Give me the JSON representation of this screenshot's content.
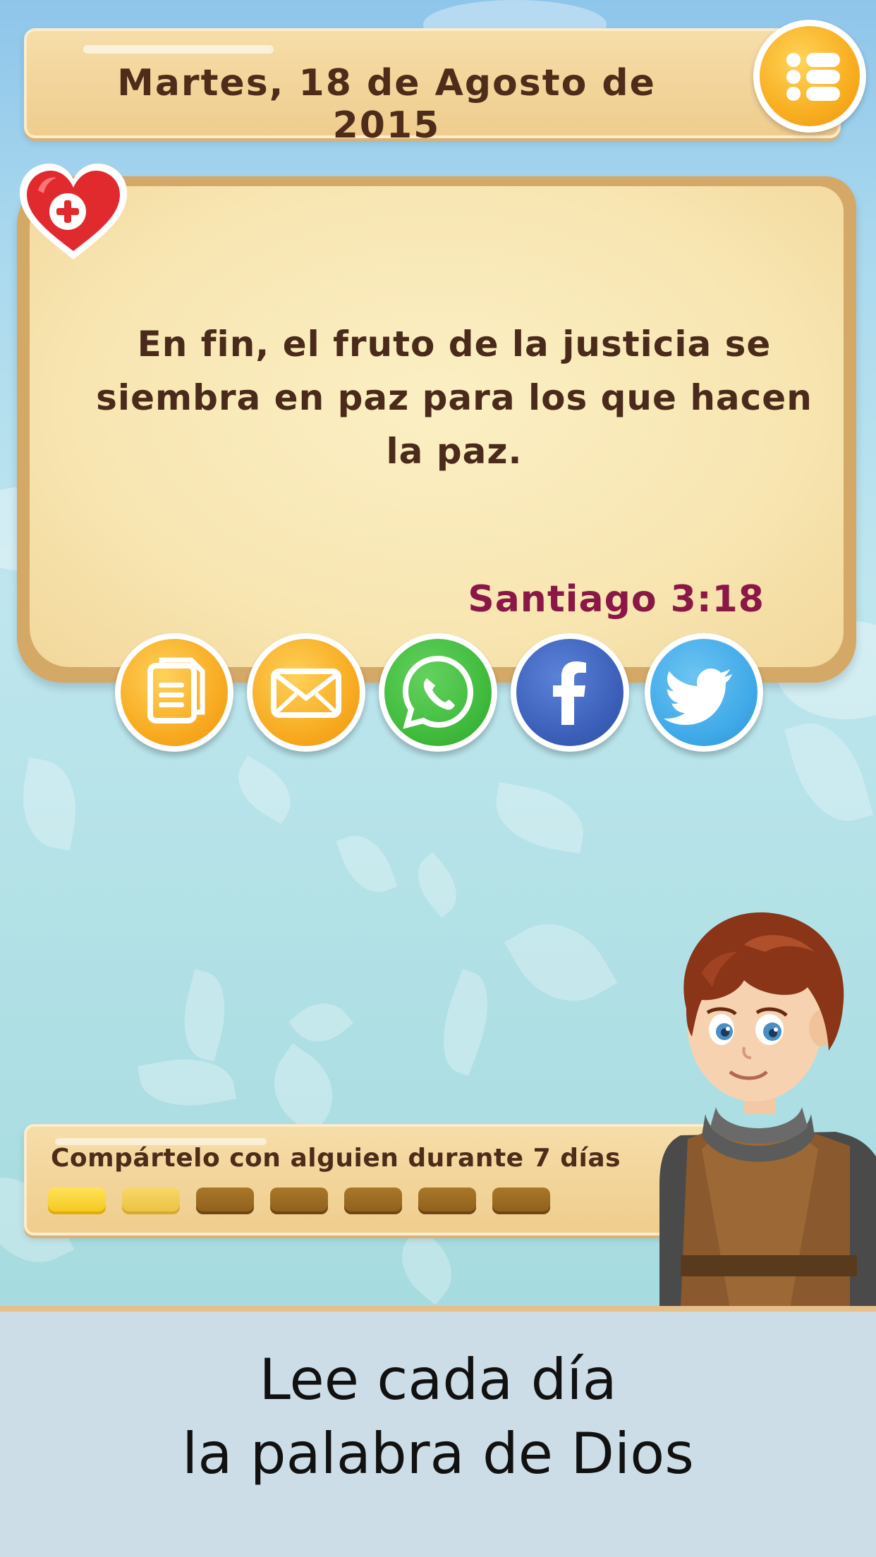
{
  "header": {
    "date": "Martes, 18 de Agosto de 2015",
    "menu_icon": "list-menu-icon"
  },
  "verse": {
    "text": "En fin, el fruto de la justicia se siembra en paz para los que hacen la paz.",
    "reference": "Santiago 3:18",
    "favorite_icon": "heart-plus-icon"
  },
  "share_buttons": [
    {
      "name": "copy",
      "icon": "document-copy-icon",
      "color": "#f6a91e"
    },
    {
      "name": "email",
      "icon": "envelope-icon",
      "color": "#f6a91e"
    },
    {
      "name": "whatsapp",
      "icon": "whatsapp-icon",
      "color": "#3fba3c"
    },
    {
      "name": "facebook",
      "icon": "facebook-icon",
      "color": "#3b5fb8"
    },
    {
      "name": "twitter",
      "icon": "twitter-bird-icon",
      "color": "#3fa9e8"
    }
  ],
  "streak": {
    "label": "Compártelo con alguien durante 7 días",
    "days_total": 7,
    "days_completed": 2
  },
  "caption": {
    "line1": "Lee cada día",
    "line2": "la palabra de Dios"
  },
  "colors": {
    "panel": "#f2d597",
    "text_brown": "#4e2c1a",
    "reference": "#8a1846",
    "accent_orange": "#f8ae1f"
  }
}
